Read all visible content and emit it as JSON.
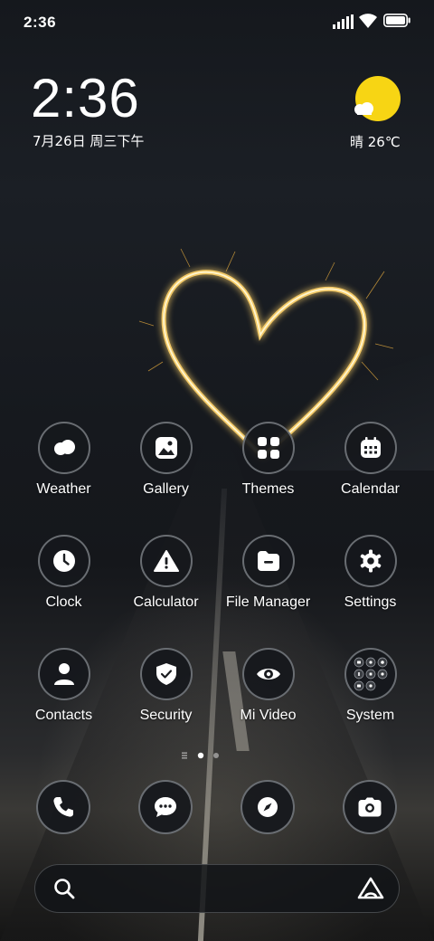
{
  "status_bar": {
    "time": "2:36"
  },
  "clock_widget": {
    "time": "2:36",
    "date": "7月26日 周三下午"
  },
  "weather_widget": {
    "text": "晴 26℃",
    "sun_color": "#f7d514"
  },
  "apps": [
    {
      "label": "Weather",
      "icon": "weather-icon"
    },
    {
      "label": "Gallery",
      "icon": "gallery-icon"
    },
    {
      "label": "Themes",
      "icon": "themes-icon"
    },
    {
      "label": "Calendar",
      "icon": "calendar-icon"
    },
    {
      "label": "Clock",
      "icon": "clock-icon"
    },
    {
      "label": "Calculator",
      "icon": "calculator-icon"
    },
    {
      "label": "File Manager",
      "icon": "file-manager-icon"
    },
    {
      "label": "Settings",
      "icon": "settings-icon"
    },
    {
      "label": "Contacts",
      "icon": "contacts-icon"
    },
    {
      "label": "Security",
      "icon": "security-icon"
    },
    {
      "label": "Mi Video",
      "icon": "mi-video-icon"
    },
    {
      "label": "System",
      "icon": "system-folder-icon"
    }
  ],
  "page_indicator": {
    "pages": 2,
    "current": 1
  },
  "dock": [
    {
      "icon": "phone-icon"
    },
    {
      "icon": "messages-icon"
    },
    {
      "icon": "browser-icon"
    },
    {
      "icon": "camera-icon"
    }
  ],
  "search_bar": {
    "search_icon": "search-icon",
    "assistant_icon": "assistant-icon"
  }
}
